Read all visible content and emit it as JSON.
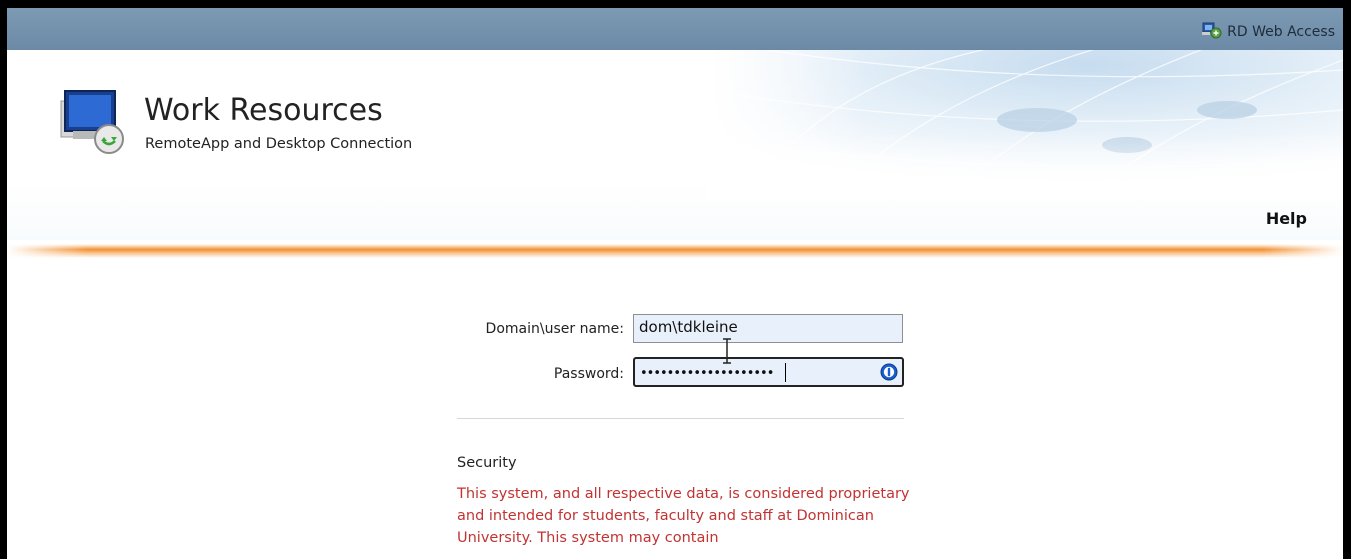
{
  "topbar": {
    "link_label": "RD Web Access",
    "icon": "rd-web-access-icon"
  },
  "header": {
    "title": "Work Resources",
    "subtitle": "RemoteApp and Desktop Connection",
    "help_label": "Help"
  },
  "login": {
    "username_label": "Domain\\user name:",
    "username_value": "dom\\tdkleine",
    "password_label": "Password:",
    "password_mask": "••••••••••••••••••••",
    "password_manager_icon": "password-manager-icon"
  },
  "security": {
    "title": "Security",
    "text": "This system, and all respective data, is considered proprietary and intended for students, faculty and staff at Dominican University. This system may contain"
  },
  "colors": {
    "topbar": "#6c8aa6",
    "accent_orange": "#f18c28",
    "warning_text": "#c23333",
    "input_bg": "#e8f0fb"
  }
}
